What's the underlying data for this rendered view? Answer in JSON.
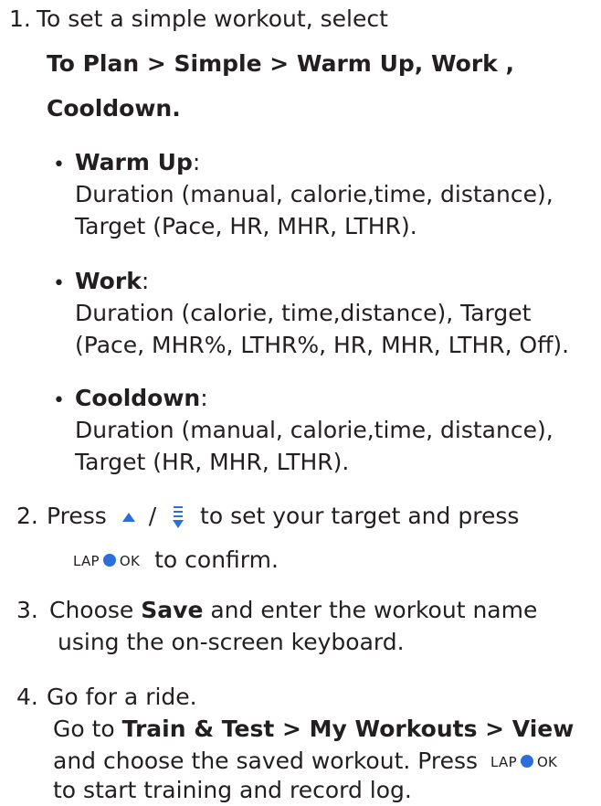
{
  "step1": {
    "number": "1.",
    "intro": "To set a simple workout, select",
    "path_line1": "To Plan > Simple > Warm Up, Work ,",
    "path_line2": "Cooldown.",
    "items": [
      {
        "bullet": "•",
        "title": "Warm Up",
        "suffix": ":",
        "line1": "Duration (manual, calorie,time, distance),",
        "line2": "Target (Pace, HR, MHR, LTHR)."
      },
      {
        "bullet": "•",
        "title": "Work",
        "suffix": ":",
        "line1": "Duration (calorie, time,distance), Target",
        "line2": "(Pace, MHR%, LTHR%, HR, MHR, LTHR, Off)."
      },
      {
        "bullet": "•",
        "title": "Cooldown",
        "suffix": ":",
        "line1": "Duration (manual, calorie,time, distance),",
        "line2": "Target (HR, MHR, LTHR)."
      }
    ]
  },
  "step2": {
    "number": "2.",
    "press": "Press",
    "slash": "/",
    "rest": "to set your target and press",
    "confirm": "to confirm."
  },
  "lap_ok": {
    "lap": "LAP",
    "ok": "OK"
  },
  "step3": {
    "number": "3.",
    "choose": "Choose",
    "save": "Save",
    "rest": "and enter the workout name",
    "line2": "using the on-screen keyboard."
  },
  "step4": {
    "number": "4.",
    "line1": "Go for a ride.",
    "goto": "Go to",
    "path": "Train & Test > My Workouts > View",
    "line3": "and choose the saved workout. Press",
    "line4": "to start training and record log."
  },
  "icons": {
    "up": "up-triangle-icon",
    "down": "down-menu-icon",
    "lap_ok": "lap-ok-button-icon"
  },
  "colors": {
    "text": "#231f20",
    "accent": "#2a6fdb"
  }
}
